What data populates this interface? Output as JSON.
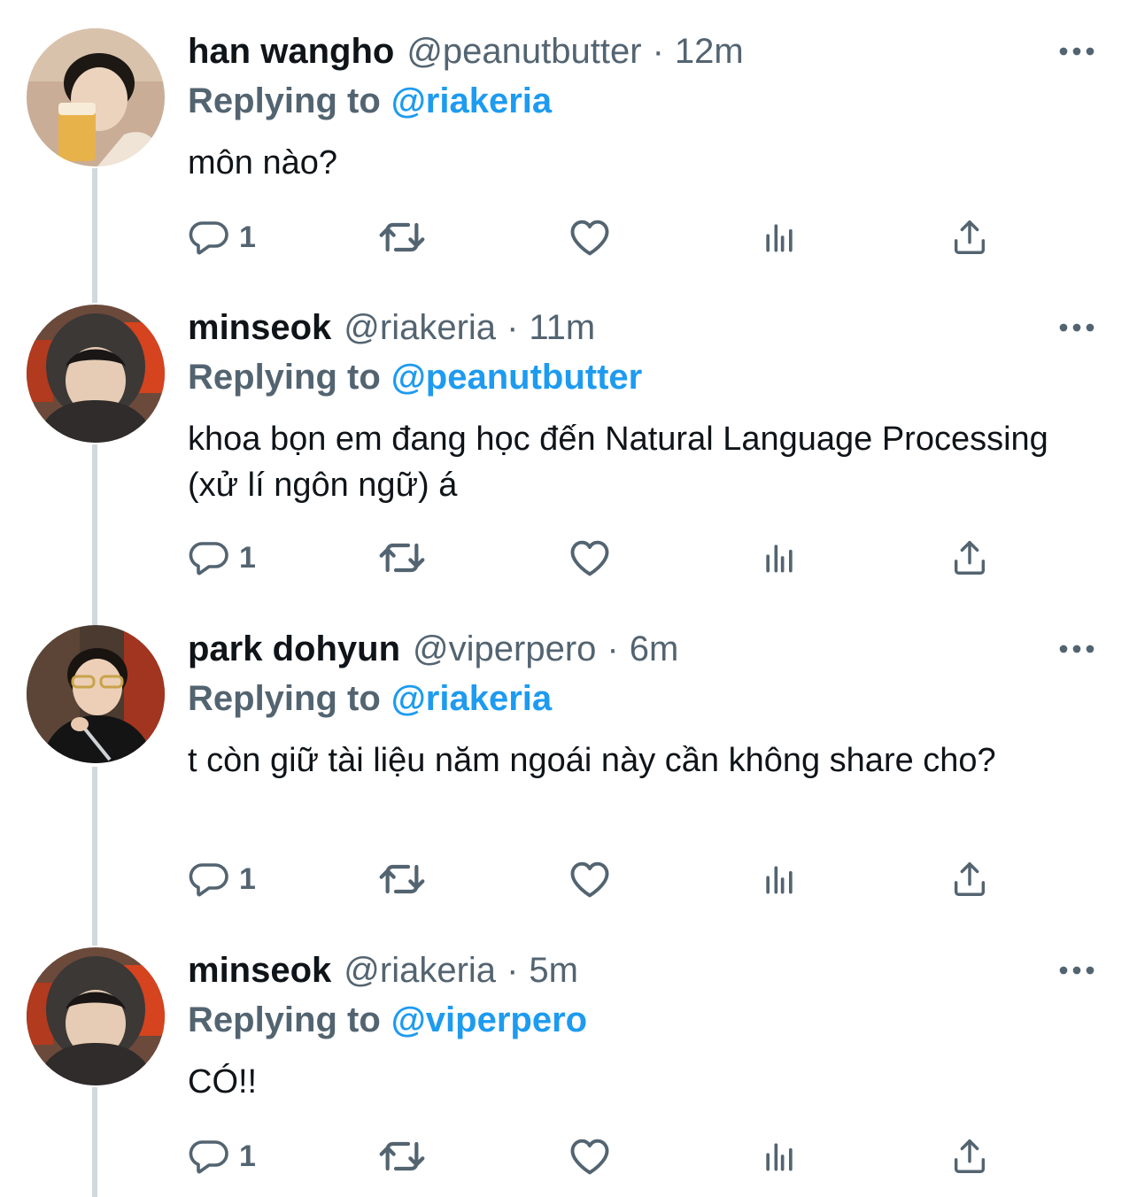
{
  "tweets": [
    {
      "name": "han wangho",
      "handle": "@peanutbutter",
      "separator": "·",
      "time": "12m",
      "replying_label": "Replying to",
      "replying_to": "@riakeria",
      "text": "môn nào?",
      "reply_count": "1"
    },
    {
      "name": "minseok",
      "handle": "@riakeria",
      "separator": "·",
      "time": "11m",
      "replying_label": "Replying to",
      "replying_to": "@peanutbutter",
      "text": "khoa bọn em đang học đến Natural Language Processing (xử lí ngôn ngữ) á",
      "reply_count": "1"
    },
    {
      "name": "park dohyun",
      "handle": "@viperpero",
      "separator": "·",
      "time": "6m",
      "replying_label": "Replying to",
      "replying_to": "@riakeria",
      "text": "t còn giữ tài liệu năm ngoái này cần không share cho?",
      "reply_count": "1"
    },
    {
      "name": "minseok",
      "handle": "@riakeria",
      "separator": "·",
      "time": "5m",
      "replying_label": "Replying to",
      "replying_to": "@viperpero",
      "text": "CÓ!!",
      "reply_count": "1"
    }
  ],
  "icons": {
    "reply": "reply-icon",
    "retweet": "retweet-icon",
    "like": "heart-icon",
    "views": "views-icon",
    "share": "share-icon",
    "more": "more-icon"
  },
  "colors": {
    "text": "#0f1419",
    "secondary": "#536471",
    "link": "#1d9bf0",
    "thread_line": "#cfd9de"
  }
}
